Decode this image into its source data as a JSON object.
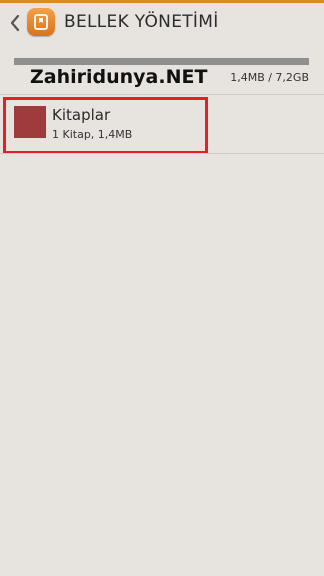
{
  "header": {
    "title": "BELLEK YÖNETİMİ",
    "back_icon": "chevron-left-icon",
    "app_icon": "book-icon"
  },
  "storage": {
    "watermark": "Zahiridunya.NET",
    "usage_text": "1,4MB / 7,2GB",
    "used_fraction": 0.0002
  },
  "items": [
    {
      "title": "Kitaplar",
      "subtitle": "1 Kitap, 1,4MB",
      "color": "#9f3a3d"
    }
  ],
  "colors": {
    "accent": "#d98a2b",
    "highlight": "#e3202a",
    "background": "#e7e4e0"
  }
}
